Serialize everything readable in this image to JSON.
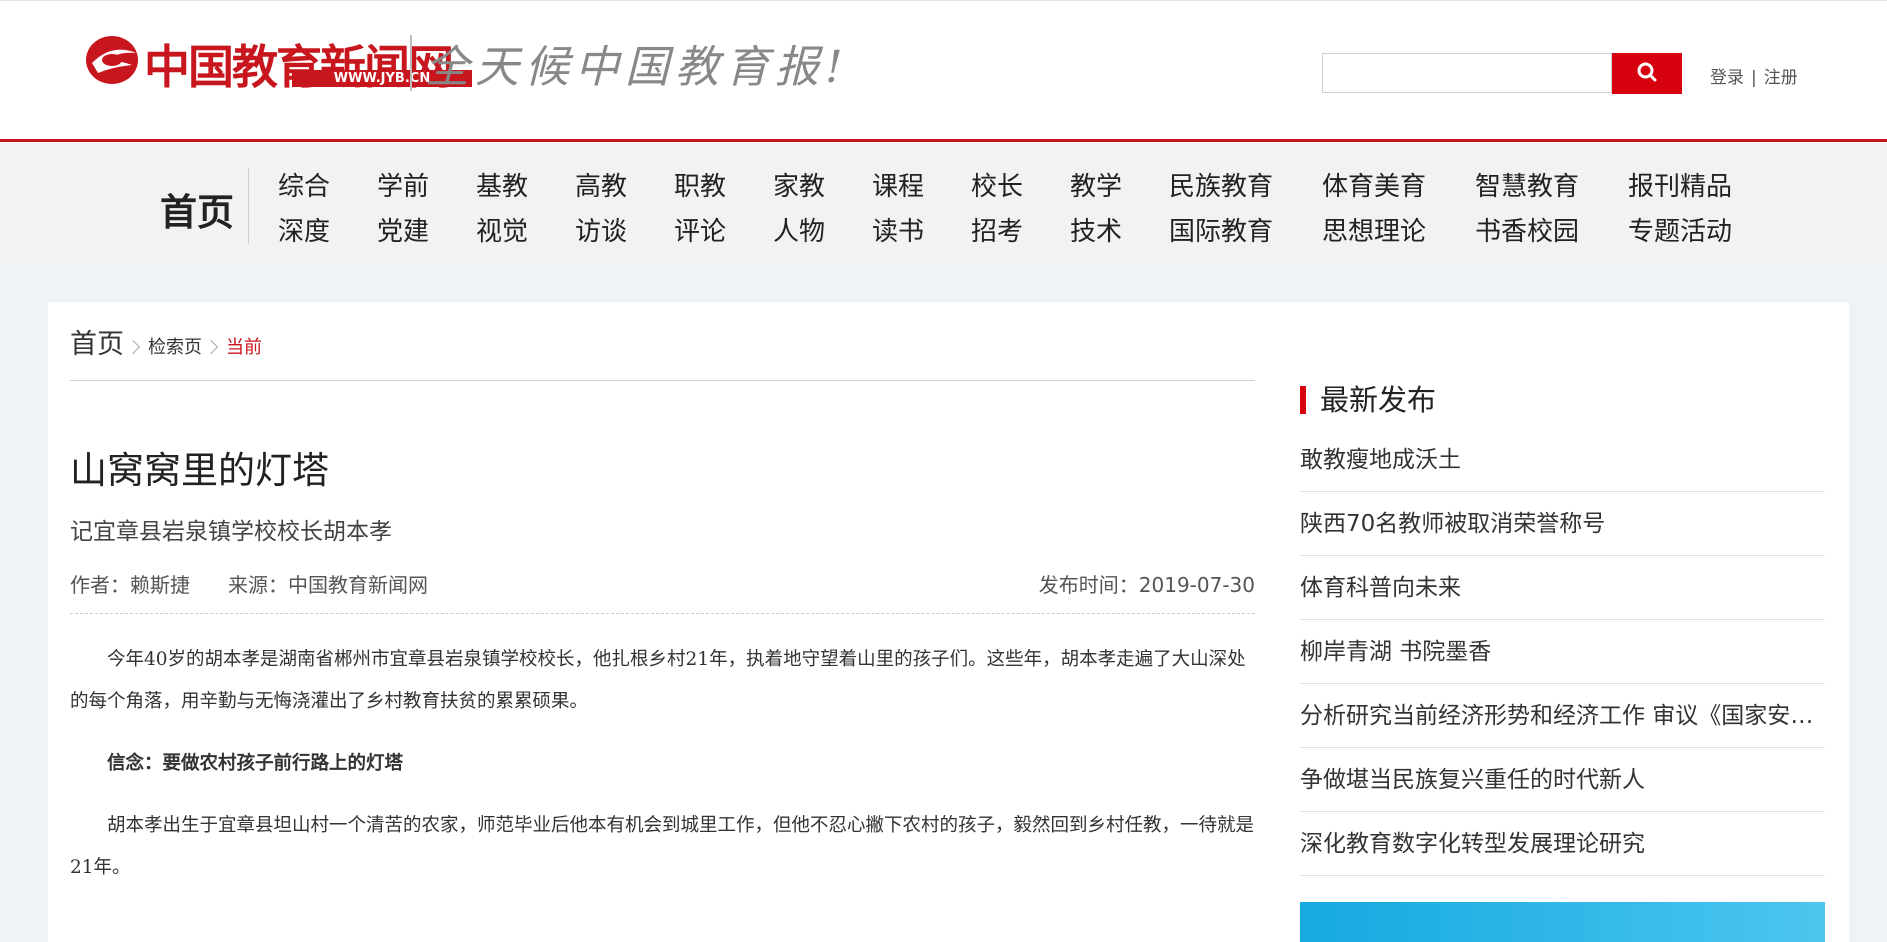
{
  "header": {
    "logo_text": "中国教育新闻网",
    "logo_url": "WWW.JYB.CN",
    "slogan": "全天候中国教育报!",
    "search": {
      "value": "",
      "placeholder": ""
    },
    "login_label": "登录",
    "register_label": "注册",
    "auth_separator": "|",
    "accent_color": "#d7000f"
  },
  "nav": {
    "home": "首页",
    "row1": [
      "综合",
      "学前",
      "基教",
      "高教",
      "职教",
      "家教",
      "课程",
      "校长",
      "教学",
      "民族教育",
      "体育美育",
      "智慧教育",
      "报刊精品"
    ],
    "row2": [
      "深度",
      "党建",
      "视觉",
      "访谈",
      "评论",
      "人物",
      "读书",
      "招考",
      "技术",
      "国际教育",
      "思想理论",
      "书香校园",
      "专题活动"
    ]
  },
  "breadcrumb": {
    "home": "首页",
    "search": "检索页",
    "current": "当前"
  },
  "article": {
    "title": "山窝窝里的灯塔",
    "subtitle": "记宜章县岩泉镇学校校长胡本孝",
    "author": "作者：赖斯捷",
    "source": "来源：中国教育新闻网",
    "date": "发布时间：2019-07-30",
    "paragraphs": [
      "今年40岁的胡本孝是湖南省郴州市宜章县岩泉镇学校校长，他扎根乡村21年，执着地守望着山里的孩子们。这些年，胡本孝走遍了大山深处的每个角落，用辛勤与无悔浇灌出了乡村教育扶贫的累累硕果。",
      "信念：要做农村孩子前行路上的灯塔",
      "胡本孝出生于宜章县坦山村一个清苦的农家，师范毕业后他本有机会到城里工作，但他不忍心撇下农村的孩子，毅然回到乡村任教，一待就是21年。"
    ]
  },
  "sidebar": {
    "title": "最新发布",
    "items": [
      "敢教瘦地成沃土",
      "陕西70名教师被取消荣誉称号",
      "体育科普向未来",
      "柳岸青湖 书院墨香",
      "分析研究当前经济形势和经济工作 审议《国家安全战略纲要》",
      "争做堪当民族复兴重任的时代新人",
      "深化教育数字化转型发展理论研究"
    ]
  }
}
